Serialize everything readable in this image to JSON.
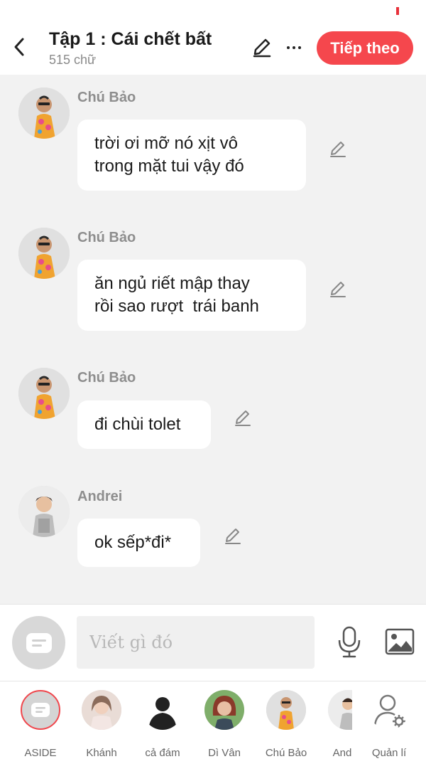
{
  "header": {
    "title": "Tập 1 : Cái chết bất",
    "subtitle": "515 chữ",
    "next_label": "Tiếp theo"
  },
  "messages": [
    {
      "sender": "Chú Bảo",
      "line1": "trời ơi mỡ nó xịt vô",
      "line2": "trong mặt tui vậy đó"
    },
    {
      "sender": "Chú Bảo",
      "line1": "ăn ngủ riết mập thay",
      "line2": "rồi sao rượt  trái banh"
    },
    {
      "sender": "Chú Bảo",
      "line1": "đi chùi tolet"
    },
    {
      "sender": "Andrei",
      "line1": "ok sếp*đi*"
    }
  ],
  "composer": {
    "placeholder": "Viết gì đó"
  },
  "characters": [
    {
      "label": "ASIDE"
    },
    {
      "label": "Khánh"
    },
    {
      "label": "cả đám"
    },
    {
      "label": "Dì Vân"
    },
    {
      "label": "Chú Bảo"
    },
    {
      "label": "And"
    },
    {
      "label": "Quản lí"
    }
  ],
  "colors": {
    "accent": "#f5474d",
    "background": "#f2f2f2",
    "bubble": "#ffffff"
  }
}
